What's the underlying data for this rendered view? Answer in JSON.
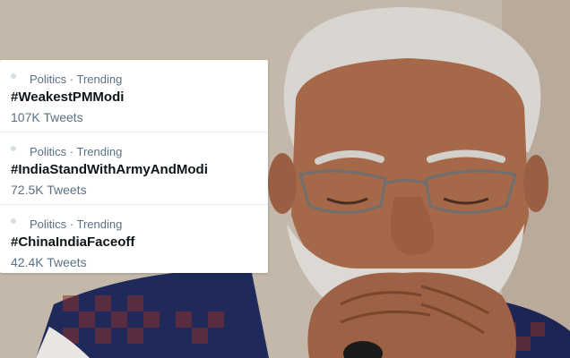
{
  "trends": [
    {
      "category": "Politics · Trending",
      "hashtag": "#WeakestPMModi",
      "tweets": "107K Tweets"
    },
    {
      "category": "Politics · Trending",
      "hashtag": "#IndiaStandWithArmyAndModi",
      "tweets": "72.5K Tweets"
    },
    {
      "category": "Politics · Trending",
      "hashtag": "#ChinaIndiaFaceoff",
      "tweets": "42.4K Tweets"
    }
  ],
  "colors": {
    "category_text": "#5b7083",
    "hashtag_text": "#0f1419",
    "card_background": "#ffffff",
    "divider": "#e6ecf0"
  }
}
